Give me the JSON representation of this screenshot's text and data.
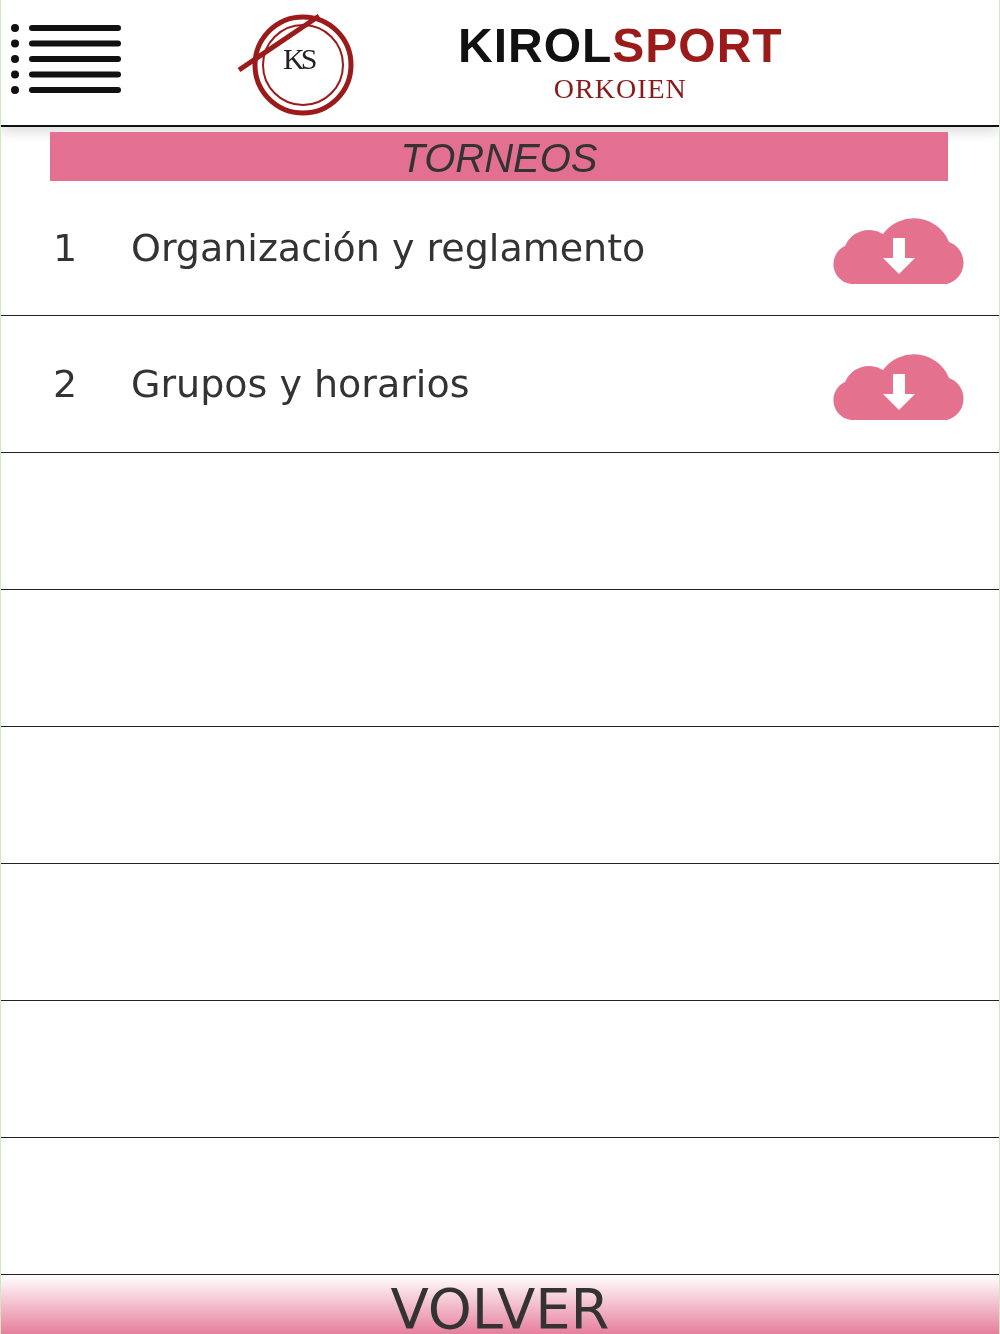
{
  "header": {
    "logo_letters": "KS",
    "brand_dark": "KIROL",
    "brand_accent": "SPORT",
    "subtitle": "ORKOIEN"
  },
  "section_title": "TORNEOS",
  "documents": [
    {
      "number": "1",
      "title": "Organización y reglamento"
    },
    {
      "number": "2",
      "title": "Grupos y horarios"
    }
  ],
  "footer_button": "VOLVER"
}
